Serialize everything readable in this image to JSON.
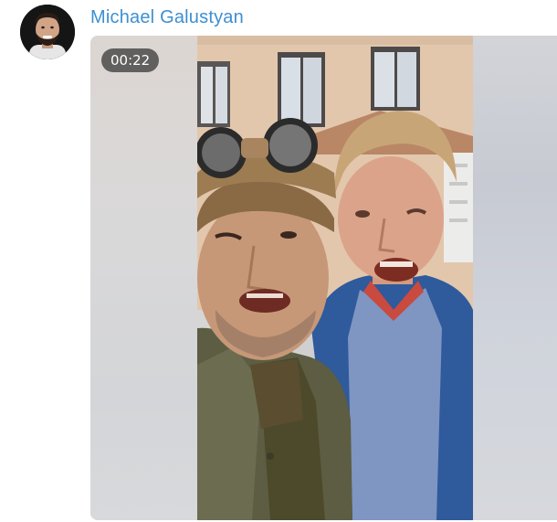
{
  "message": {
    "sender_name": "Michael Galustyan",
    "video": {
      "duration": "00:22"
    }
  },
  "colors": {
    "sender_name": "#3d8fd1",
    "duration_badge_bg": "#464646"
  }
}
